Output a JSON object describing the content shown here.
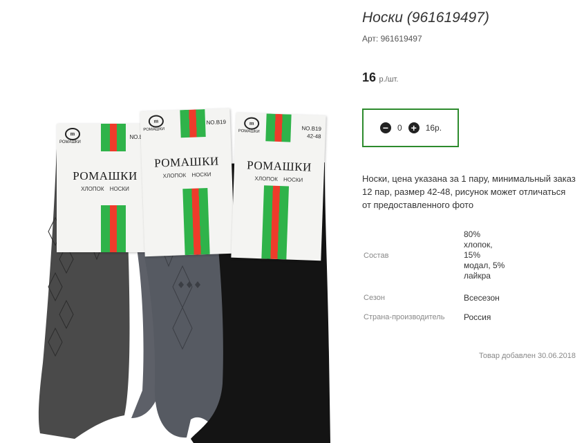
{
  "product": {
    "title": "Носки (961619497)",
    "sku": "Арт: 961619497",
    "price": "16",
    "price_unit": "р./шт.",
    "quantity": "0",
    "sum": "16р.",
    "description": "Носки, цена указана за 1 пару, минимальный заказ 12 пар, размер 42-48, рисунок может отличаться от предоставленного фото",
    "added": "Товар добавлен 30.06.2018"
  },
  "properties": [
    {
      "label": "Состав",
      "value": "80% хлопок, 15% модал, 5% лайкра"
    },
    {
      "label": "Сезон",
      "value": "Всесезон"
    },
    {
      "label": "Страна-производитель",
      "value": "Россия"
    }
  ],
  "image": {
    "brand": "РОМАШКИ",
    "subtitle": "ХЛОПОК НОСКИ",
    "logo_sub": "РОМАШКИ",
    "code": "NO.B19",
    "size": "42-48",
    "colors": {
      "sock_dark": "#4a4a4a",
      "sock_grey": "#5d6068",
      "sock_black": "#141414",
      "stripe_green": "#2fb34a",
      "stripe_red": "#ee3b2b",
      "border": "#2c8a2c"
    }
  }
}
